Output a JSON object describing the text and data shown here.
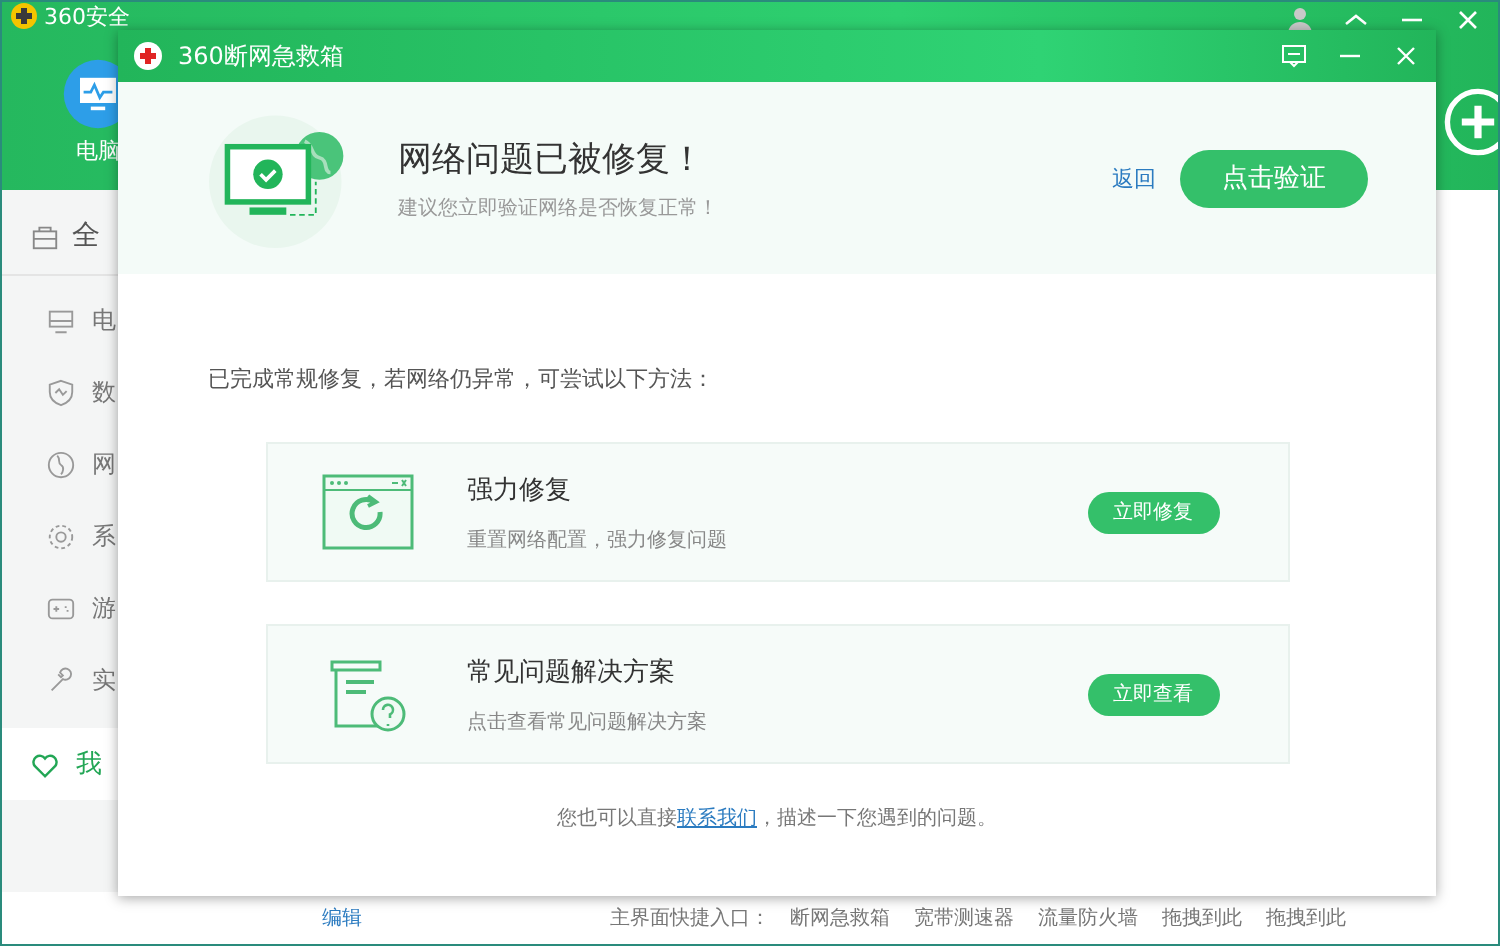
{
  "main_window": {
    "title": "360安全",
    "header_tool": {
      "label": "电脑"
    },
    "sidebar": {
      "all": {
        "label": "全"
      },
      "items": [
        {
          "label": "电",
          "selected": false
        },
        {
          "label": "数",
          "selected": false
        },
        {
          "label": "网",
          "selected": false
        },
        {
          "label": "系",
          "selected": false
        },
        {
          "label": "游",
          "selected": false
        },
        {
          "label": "实",
          "selected": false
        },
        {
          "label": "我",
          "selected": true
        }
      ]
    },
    "bottom_bar": {
      "edit": "编辑",
      "shortcut_label": "主界面快捷入口：",
      "shortcuts": [
        "断网急救箱",
        "宽带测速器",
        "流量防火墙",
        "拖拽到此",
        "拖拽到此"
      ]
    }
  },
  "dialog": {
    "title": "360断网急救箱",
    "status": {
      "headline": "网络问题已被修复！",
      "subtitle": "建议您立即验证网络是否恢复正常！",
      "back_link": "返回",
      "verify_button": "点击验证"
    },
    "hint": "已完成常规修复，若网络仍异常，可尝试以下方法：",
    "options": [
      {
        "kind": "repair",
        "title": "强力修复",
        "description": "重置网络配置，强力修复问题",
        "button": "立即修复"
      },
      {
        "kind": "faq",
        "title": "常见问题解决方案",
        "description": "点击查看常见问题解决方案",
        "button": "立即查看"
      }
    ],
    "footer": {
      "before": "您也可以直接",
      "link": "联系我们",
      "after": "，描述一下您遇到的问题。"
    }
  }
}
